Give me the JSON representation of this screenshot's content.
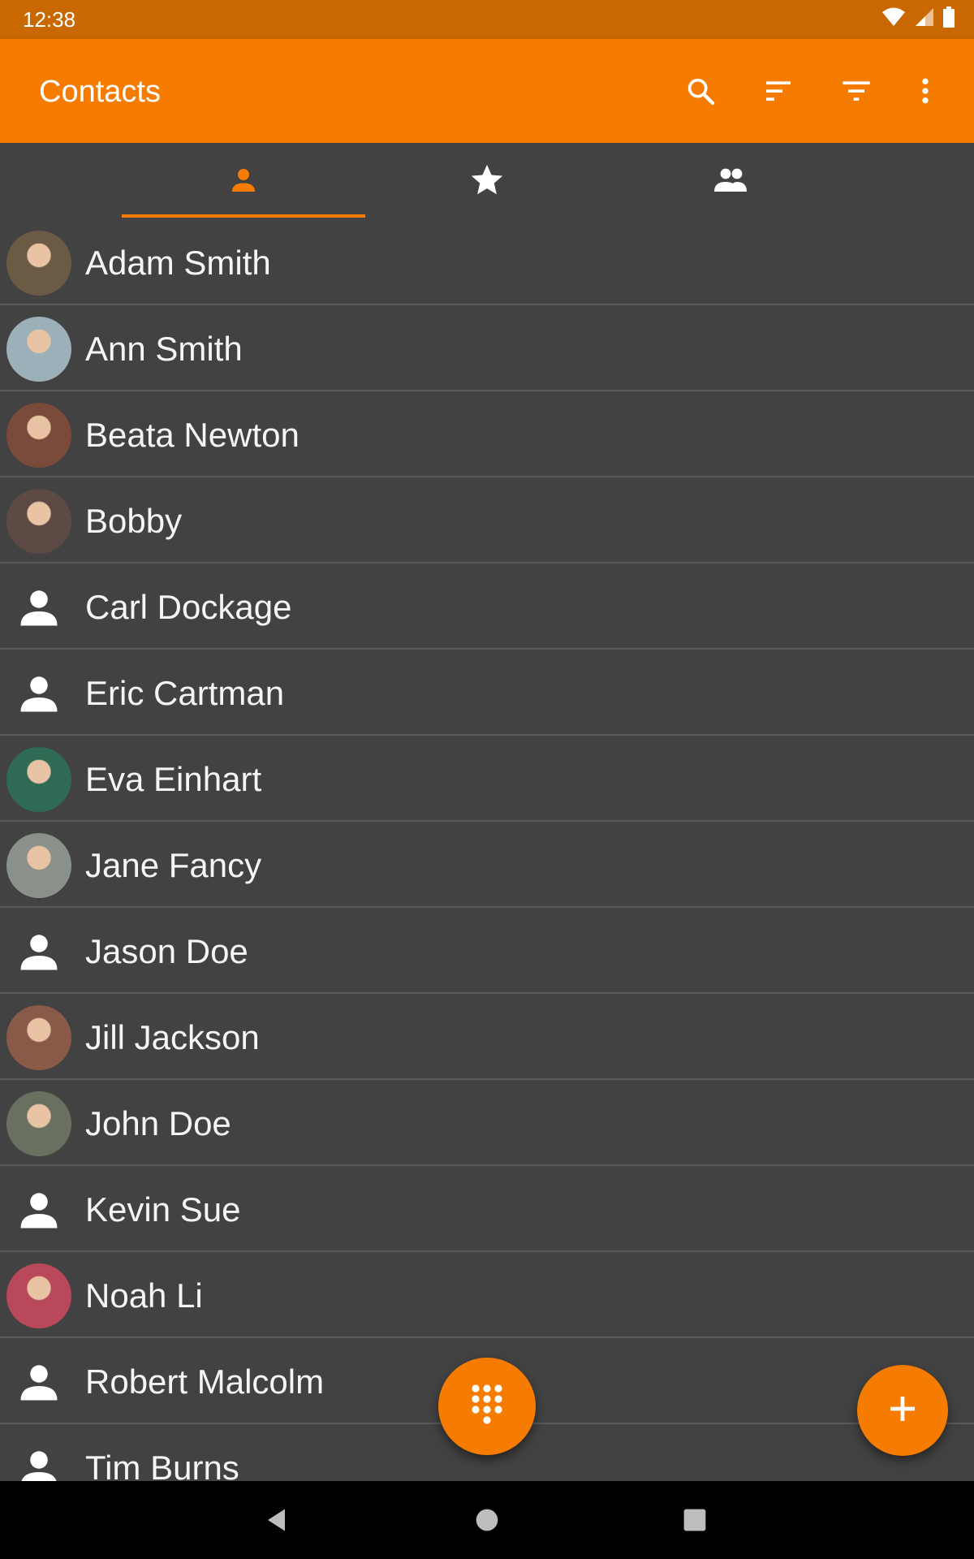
{
  "status_bar": {
    "time": "12:38"
  },
  "app_bar": {
    "title": "Contacts",
    "actions": [
      "search-icon",
      "sort-icon",
      "filter-icon",
      "more-vert-icon"
    ]
  },
  "tabs": [
    {
      "icon": "person-icon",
      "selected": true
    },
    {
      "icon": "star-icon",
      "selected": false
    },
    {
      "icon": "group-icon",
      "selected": false
    }
  ],
  "contacts": [
    {
      "name": "Adam Smith",
      "avatar": "photo",
      "color": "#6b5a44"
    },
    {
      "name": "Ann Smith",
      "avatar": "photo",
      "color": "#9bb0b8"
    },
    {
      "name": "Beata Newton",
      "avatar": "photo",
      "color": "#7a4b3a"
    },
    {
      "name": "Bobby",
      "avatar": "photo",
      "color": "#5e4a44"
    },
    {
      "name": "Carl Dockage",
      "avatar": "placeholder"
    },
    {
      "name": "Eric Cartman",
      "avatar": "placeholder"
    },
    {
      "name": "Eva Einhart",
      "avatar": "photo",
      "color": "#2f6a55"
    },
    {
      "name": "Jane Fancy",
      "avatar": "photo",
      "color": "#8a918a"
    },
    {
      "name": "Jason Doe",
      "avatar": "placeholder"
    },
    {
      "name": "Jill Jackson",
      "avatar": "photo",
      "color": "#8a5a49"
    },
    {
      "name": "John Doe",
      "avatar": "photo",
      "color": "#6a7060"
    },
    {
      "name": "Kevin Sue",
      "avatar": "placeholder"
    },
    {
      "name": "Noah Li",
      "avatar": "photo",
      "color": "#b9485a"
    },
    {
      "name": "Robert Malcolm",
      "avatar": "placeholder"
    },
    {
      "name": "Tim Burns",
      "avatar": "placeholder"
    }
  ],
  "fabs": {
    "dialpad": "dialpad-icon",
    "add": "add-icon"
  },
  "colors": {
    "accent": "#F57C00",
    "status_bar": "#C96800",
    "background": "#424242"
  }
}
